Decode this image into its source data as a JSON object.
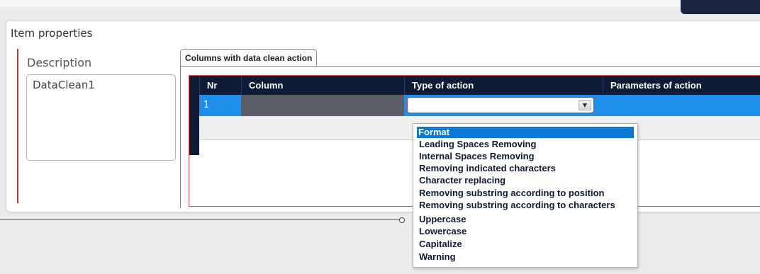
{
  "panel": {
    "title": "Item properties"
  },
  "description": {
    "label": "Description",
    "value": "DataClean1"
  },
  "tab": {
    "label": "Columns with data clean action"
  },
  "grid": {
    "columns": [
      "Nr",
      "Column",
      "Type of action",
      "Parameters of action"
    ],
    "rows": [
      {
        "nr": "1",
        "column": "",
        "type_of_action": "",
        "parameters": ""
      }
    ]
  },
  "dropdown": {
    "options": [
      "Format",
      "Leading Spaces Removing",
      "Internal Spaces Removing",
      "Removing indicated characters",
      "Character replacing",
      "Removing substring according to position",
      "Removing substring according to characters",
      "Uppercase",
      "Lowercase",
      "Capitalize",
      "Warning"
    ],
    "highlighted": "Format"
  },
  "colors": {
    "header_bg": "#0f1a36",
    "selection": "#0b78d6",
    "accent_red": "#cc3b3b"
  },
  "icons": {
    "dropdown_arrow": "chevron-down-icon"
  }
}
